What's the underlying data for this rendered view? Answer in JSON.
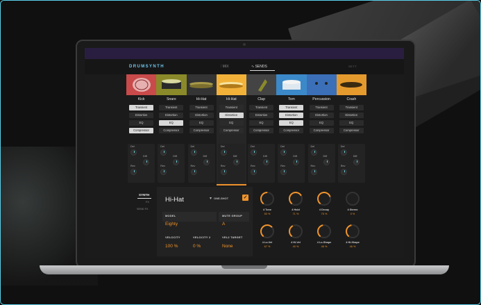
{
  "app": {
    "logo": "DRUMSYNTH"
  },
  "header": {
    "tabs": [
      {
        "label": "MIX"
      },
      {
        "label": "SENDS"
      }
    ],
    "right_label": "SETT"
  },
  "colors": {
    "accent": "#f0932b",
    "logo": "#6fc7ee",
    "pad_colors": [
      "#c94a4a",
      "#8a8a2a",
      "#343434",
      "#f2b23a",
      "#444",
      "#3b89c8",
      "#3b6fb8",
      "#e59a2d"
    ]
  },
  "lanes": [
    {
      "name": "Kick",
      "fx": [
        "Transient",
        "Distortion",
        "EQ",
        "Compressor"
      ]
    },
    {
      "name": "Snare",
      "fx": [
        "Transient",
        "Distortion",
        "EQ",
        "Compressor"
      ]
    },
    {
      "name": "Hi-Hat",
      "fx": [
        "Transient",
        "Distortion",
        "EQ",
        "Compressor"
      ]
    },
    {
      "name": "Hi-Hat",
      "fx": [
        "Transient",
        "Distortion",
        "EQ",
        "Compressor"
      ]
    },
    {
      "name": "Clap",
      "fx": [
        "Transient",
        "Distortion",
        "EQ",
        "Compressor"
      ]
    },
    {
      "name": "Tom",
      "fx": [
        "Transient",
        "Distortion",
        "EQ",
        "Compressor"
      ]
    },
    {
      "name": "Percussion",
      "fx": [
        "Transient",
        "Distortion",
        "EQ",
        "Compressor"
      ]
    },
    {
      "name": "Crash",
      "fx": [
        "Transient",
        "Distortion",
        "EQ",
        "Compressor"
      ]
    }
  ],
  "knob_labels": {
    "del": "Del",
    "diff": "Diff",
    "rev": "Rev"
  },
  "sidebar": {
    "synth": "SYNTH",
    "fx": "FX",
    "send_fx": "SEND FX"
  },
  "instrument": {
    "name": "Hi-Hat",
    "one_shot_label": "ONE-SHOT",
    "one_shot_checked": "✓",
    "model_label": "MODEL",
    "model_value": "Eighty",
    "mute_group_label": "MUTE GROUP",
    "mute_group_value": "A",
    "velocity_label": "VELOCITY",
    "velocity_value": "100 %",
    "velocity2_label": "VELOCITY 2",
    "velocity2_value": "0 %",
    "vel2_target_label": "VEL2 TARGET",
    "vel2_target_value": "None"
  },
  "macros": [
    {
      "name": "4 Tone",
      "value": "50 %",
      "level": 0.5
    },
    {
      "name": "4 Hold",
      "value": "71 %",
      "level": 0.71
    },
    {
      "name": "4 Decay",
      "value": "75 %",
      "level": 0.75
    },
    {
      "name": "4 Stereo",
      "value": "0 %",
      "level": 0.0
    },
    {
      "name": "4 Lo-Vel",
      "value": "67 %",
      "level": 0.67
    },
    {
      "name": "4 Hi-Vel",
      "value": "40 %",
      "level": 0.4
    },
    {
      "name": "4 Lo-Shape",
      "value": "46 %",
      "level": 0.46
    },
    {
      "name": "4 Hi-Shape",
      "value": "46 %",
      "level": 0.46
    }
  ]
}
